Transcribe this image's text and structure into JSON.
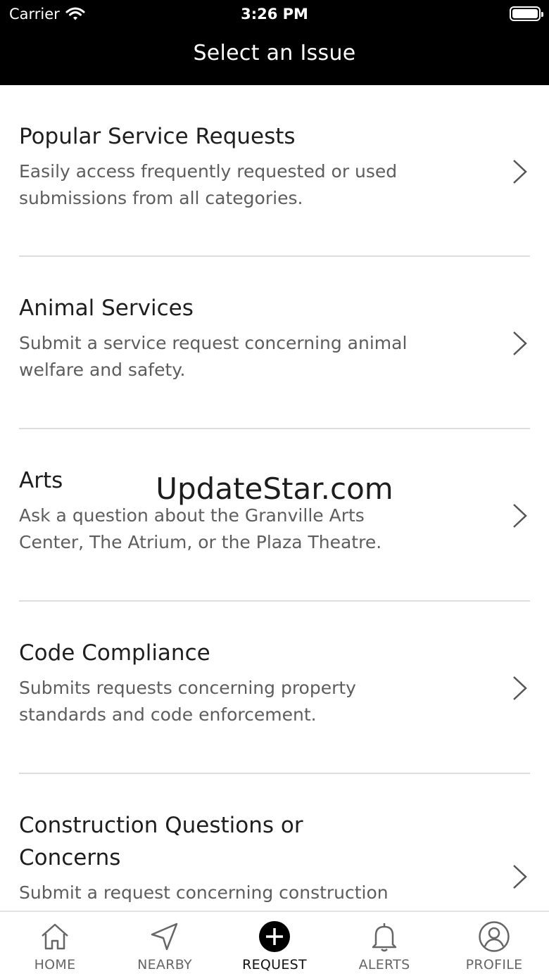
{
  "status_bar": {
    "carrier": "Carrier",
    "time": "3:26 PM"
  },
  "header": {
    "title": "Select an Issue"
  },
  "issues": [
    {
      "title": "Popular Service Requests",
      "description": "Easily access frequently requested or used submissions from all categories."
    },
    {
      "title": "Animal Services",
      "description": "Submit a service request concerning animal welfare and safety."
    },
    {
      "title": "Arts",
      "description": "Ask a question about the Granville Arts Center, The Atrium, or the Plaza Theatre."
    },
    {
      "title": "Code Compliance",
      "description": "Submits requests concerning property standards and code enforcement."
    },
    {
      "title": "Construction Questions or Concerns",
      "description": "Submit a request concerning construction"
    }
  ],
  "watermark": "UpdateStar.com",
  "tabs": [
    {
      "label": "HOME",
      "icon": "home-icon"
    },
    {
      "label": "NEARBY",
      "icon": "navigation-arrow-icon"
    },
    {
      "label": "REQUEST",
      "icon": "plus-circle-icon",
      "active": true
    },
    {
      "label": "ALERTS",
      "icon": "bell-icon"
    },
    {
      "label": "PROFILE",
      "icon": "user-circle-icon"
    }
  ],
  "colors": {
    "header_bg": "#000000",
    "header_text": "#ffffff",
    "title_text": "#1e1e1e",
    "description_text": "#5d5d5d",
    "divider": "#dddddd"
  }
}
